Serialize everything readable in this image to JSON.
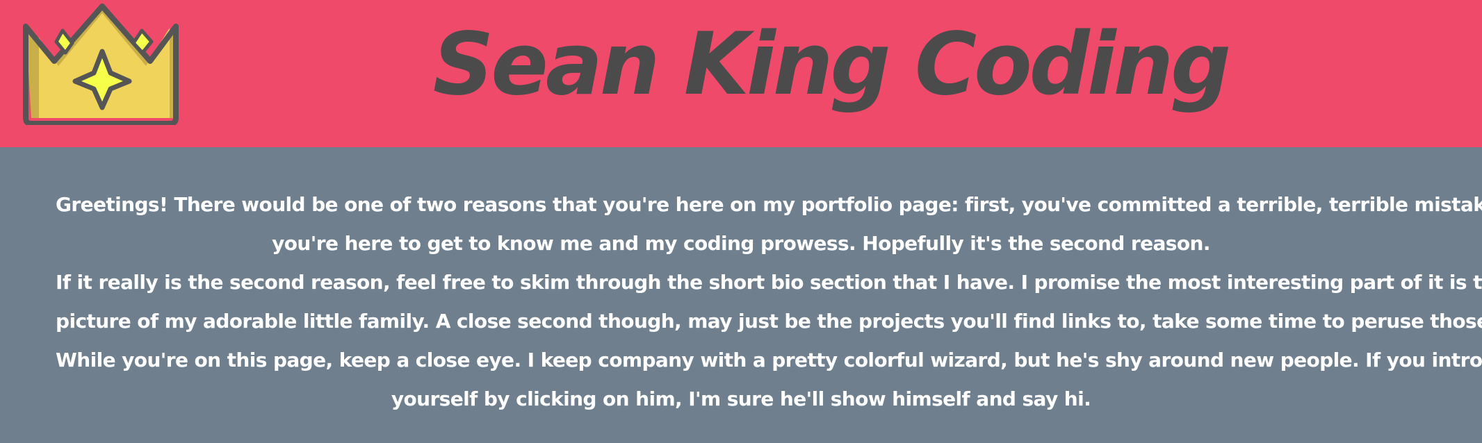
{
  "header": {
    "title": "Sean King Coding",
    "logo_icon": "crown-icon"
  },
  "intro": {
    "lines": [
      "Greetings! There would be one of two reasons that you're here on my portfolio page: first, you've committed a terrible, terrible mistake. Second,",
      "you're here to get to know me and my coding prowess. Hopefully it's the second reason.",
      "If it really is the second reason, feel free to skim through the short bio section that I have. I promise the most interesting part of it is the",
      "picture of my adorable little family. A close second though, may just be the projects you'll find links to, take some time to peruse those as well.",
      "While you're on this page, keep a close eye. I keep company with a pretty colorful wizard, but he's shy around new people. If you introduce",
      "yourself by clicking on him, I'm sure he'll show himself and say hi."
    ]
  },
  "colors": {
    "header_background": "#ef4a6a",
    "content_background": "#6f7f8e",
    "title_text": "#4b4b4b",
    "body_text": "#ffffff",
    "crown_fill": "#f0d35a",
    "crown_shadow": "#c9ae4a",
    "crown_outline": "#555555",
    "gem_fill": "#f6ff4a"
  }
}
